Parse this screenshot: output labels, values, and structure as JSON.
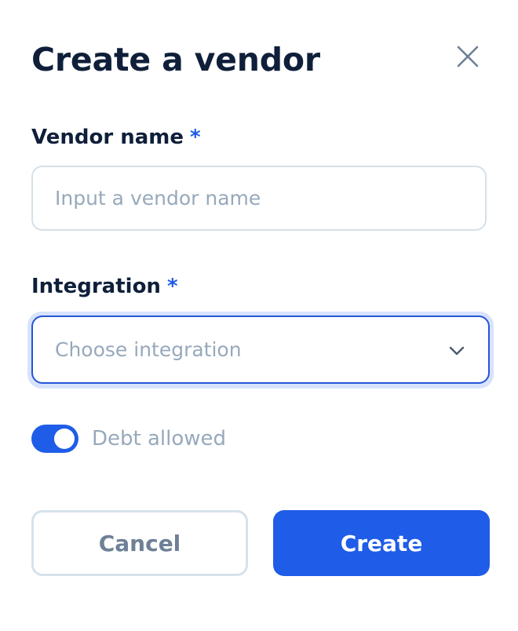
{
  "dialog": {
    "title": "Create a vendor",
    "close_icon": "close-icon"
  },
  "vendor_name": {
    "label": "Vendor name",
    "required_mark": "*",
    "value": "",
    "placeholder": "Input a vendor name"
  },
  "integration": {
    "label": "Integration",
    "required_mark": "*",
    "placeholder": "Choose integration",
    "icon": "chevron-down-icon"
  },
  "debt_toggle": {
    "label": "Debt allowed",
    "checked": true
  },
  "actions": {
    "cancel_label": "Cancel",
    "create_label": "Create"
  },
  "colors": {
    "primary": "#1f5de8",
    "heading": "#0f1f3a",
    "muted": "#97a9bb",
    "border": "#d6e0ea"
  }
}
